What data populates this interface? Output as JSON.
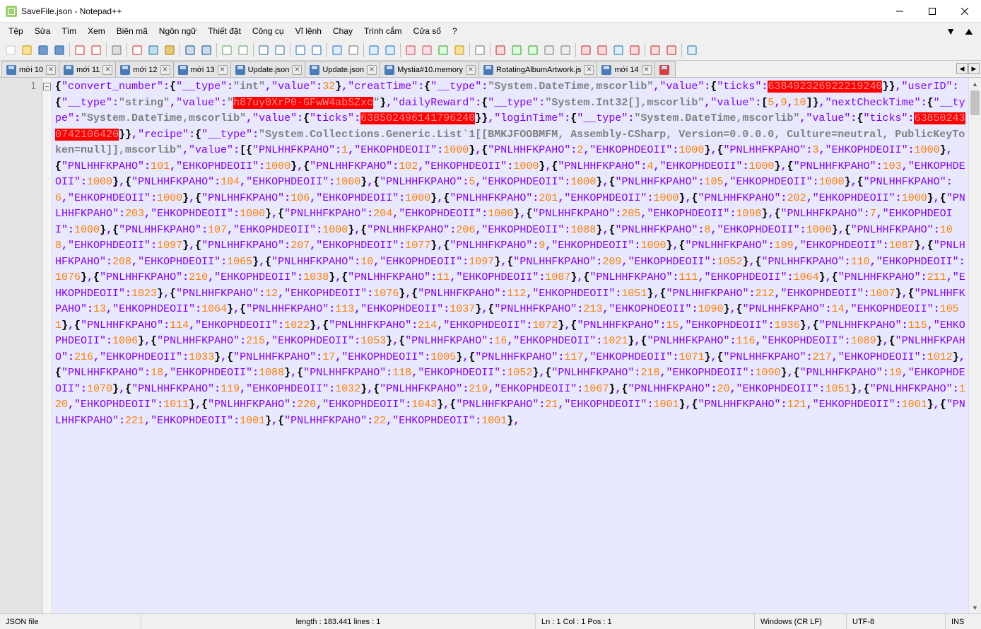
{
  "window": {
    "title": "SaveFile.json - Notepad++"
  },
  "menu": {
    "items": [
      "Tệp",
      "Sửa",
      "Tìm",
      "Xem",
      "Biên mã",
      "Ngôn ngữ",
      "Thiết đặt",
      "Công cụ",
      "Vĩ lệnh",
      "Chạy",
      "Trình cắm",
      "Cửa sổ",
      "?"
    ]
  },
  "tabs": [
    {
      "label": "mới 10",
      "unsaved": false
    },
    {
      "label": "mới 11",
      "unsaved": false
    },
    {
      "label": "mới 12",
      "unsaved": false
    },
    {
      "label": "mới 13",
      "unsaved": false
    },
    {
      "label": "Update.json",
      "unsaved": false
    },
    {
      "label": "Update.json",
      "unsaved": false
    },
    {
      "label": "Mystia#10.memory",
      "unsaved": false
    },
    {
      "label": "RotatingAlbumArtwork.js",
      "unsaved": false
    },
    {
      "label": "mới 14",
      "unsaved": false
    },
    {
      "label": "",
      "unsaved": true
    }
  ],
  "line_number": "1",
  "code_tokens": [
    {
      "t": "{",
      "c": "b"
    },
    {
      "t": "\"convert_number\"",
      "c": "k"
    },
    {
      "t": ":",
      "c": "p"
    },
    {
      "t": "{",
      "c": "b"
    },
    {
      "t": "\"__type\"",
      "c": "k"
    },
    {
      "t": ":",
      "c": "p"
    },
    {
      "t": "\"int\"",
      "c": "s"
    },
    {
      "t": ",",
      "c": "p"
    },
    {
      "t": "\"value\"",
      "c": "k"
    },
    {
      "t": ":",
      "c": "p"
    },
    {
      "t": "32",
      "c": "n"
    },
    {
      "t": "}",
      "c": "b"
    },
    {
      "t": ",",
      "c": "p"
    },
    {
      "t": "\"creatTime\"",
      "c": "k"
    },
    {
      "t": ":",
      "c": "p"
    },
    {
      "t": "{",
      "c": "b"
    },
    {
      "t": "\"__type\"",
      "c": "k"
    },
    {
      "t": ":",
      "c": "p"
    },
    {
      "t": "\"System.DateTime,mscorlib\"",
      "c": "s"
    },
    {
      "t": ",",
      "c": "p"
    },
    {
      "t": "\"value\"",
      "c": "k"
    },
    {
      "t": ":",
      "c": "p"
    },
    {
      "t": "{",
      "c": "b"
    },
    {
      "t": "\"ticks\"",
      "c": "k"
    },
    {
      "t": ":",
      "c": "p"
    },
    {
      "t": "638492326922219240",
      "c": "red"
    },
    {
      "t": "}",
      "c": "b"
    },
    {
      "t": "}",
      "c": "b"
    },
    {
      "t": ",",
      "c": "p"
    },
    {
      "t": "\"userID\"",
      "c": "k"
    },
    {
      "t": ":",
      "c": "p"
    },
    {
      "t": "{",
      "c": "b"
    },
    {
      "t": "\"__type\"",
      "c": "k"
    },
    {
      "t": ":",
      "c": "p"
    },
    {
      "t": "\"string\"",
      "c": "s"
    },
    {
      "t": ",",
      "c": "p"
    },
    {
      "t": "\"value\"",
      "c": "k"
    },
    {
      "t": ":",
      "c": "p"
    },
    {
      "t": "\"",
      "c": "s"
    },
    {
      "t": "h87uy0XrP0-GFwW4abSZxc",
      "c": "red"
    },
    {
      "t": "\"",
      "c": "s"
    },
    {
      "t": "}",
      "c": "b"
    },
    {
      "t": ",",
      "c": "p"
    },
    {
      "t": "\"dailyReward\"",
      "c": "k"
    },
    {
      "t": ":",
      "c": "p"
    },
    {
      "t": "{",
      "c": "b"
    },
    {
      "t": "\"__type\"",
      "c": "k"
    },
    {
      "t": ":",
      "c": "p"
    },
    {
      "t": "\"System.Int32[],mscorlib\"",
      "c": "s"
    },
    {
      "t": ",",
      "c": "p"
    },
    {
      "t": "\"value\"",
      "c": "k"
    },
    {
      "t": ":",
      "c": "p"
    },
    {
      "t": "[",
      "c": "b"
    },
    {
      "t": "5",
      "c": "n"
    },
    {
      "t": ",",
      "c": "p"
    },
    {
      "t": "9",
      "c": "n"
    },
    {
      "t": ",",
      "c": "p"
    },
    {
      "t": "10",
      "c": "n"
    },
    {
      "t": "]",
      "c": "b"
    },
    {
      "t": "}",
      "c": "b"
    },
    {
      "t": ",",
      "c": "p"
    },
    {
      "t": "\"nextCheckTime\"",
      "c": "k"
    },
    {
      "t": ":",
      "c": "p"
    },
    {
      "t": "{",
      "c": "b"
    },
    {
      "t": "\"__type\"",
      "c": "k"
    },
    {
      "t": ":",
      "c": "p"
    },
    {
      "t": "\"System.DateTime,mscorlib\"",
      "c": "s"
    },
    {
      "t": ",",
      "c": "p"
    },
    {
      "t": "\"value\"",
      "c": "k"
    },
    {
      "t": ":",
      "c": "p"
    },
    {
      "t": "{",
      "c": "b"
    },
    {
      "t": "\"ticks\"",
      "c": "k"
    },
    {
      "t": ":",
      "c": "p"
    },
    {
      "t": "638502496141796240",
      "c": "red"
    },
    {
      "t": "}",
      "c": "b"
    },
    {
      "t": "}",
      "c": "b"
    },
    {
      "t": ",",
      "c": "p"
    },
    {
      "t": "\"loginTime\"",
      "c": "k"
    },
    {
      "t": ":",
      "c": "p"
    },
    {
      "t": "{",
      "c": "b"
    },
    {
      "t": "\"__type\"",
      "c": "k"
    },
    {
      "t": ":",
      "c": "p"
    },
    {
      "t": "\"System.DateTime,mscorlib\"",
      "c": "s"
    },
    {
      "t": ",",
      "c": "p"
    },
    {
      "t": "\"value\"",
      "c": "k"
    },
    {
      "t": ":",
      "c": "p"
    },
    {
      "t": "{",
      "c": "b"
    },
    {
      "t": "\"ticks\"",
      "c": "k"
    },
    {
      "t": ":",
      "c": "p"
    },
    {
      "t": "638502430742106420",
      "c": "red"
    },
    {
      "t": "}",
      "c": "b"
    },
    {
      "t": "}",
      "c": "b"
    },
    {
      "t": ",",
      "c": "p"
    },
    {
      "t": "\"recipe\"",
      "c": "k"
    },
    {
      "t": ":",
      "c": "p"
    },
    {
      "t": "{",
      "c": "b"
    },
    {
      "t": "\"__type\"",
      "c": "k"
    },
    {
      "t": ":",
      "c": "p"
    },
    {
      "t": "\"System.Collections.Generic.List`1[[BMKJFOOBMFM, Assembly-CSharp, Version=0.0.0.0, Culture=neutral, PublicKeyToken=null]],mscorlib\"",
      "c": "s"
    },
    {
      "t": ",",
      "c": "p"
    },
    {
      "t": "\"value\"",
      "c": "k"
    },
    {
      "t": ":",
      "c": "p"
    },
    {
      "t": "[",
      "c": "b"
    }
  ],
  "recipe_items": [
    {
      "p": 1,
      "e": 1000
    },
    {
      "p": 2,
      "e": 1000
    },
    {
      "p": 3,
      "e": 1000
    },
    {
      "p": 101,
      "e": 1000
    },
    {
      "p": 102,
      "e": 1000
    },
    {
      "p": 4,
      "e": 1000
    },
    {
      "p": 103,
      "e": 1000
    },
    {
      "p": 104,
      "e": 1000
    },
    {
      "p": 5,
      "e": 1000
    },
    {
      "p": 105,
      "e": 1000
    },
    {
      "p": 6,
      "e": 1000
    },
    {
      "p": 106,
      "e": 1000
    },
    {
      "p": 201,
      "e": 1000
    },
    {
      "p": 202,
      "e": 1000
    },
    {
      "p": 203,
      "e": 1000
    },
    {
      "p": 204,
      "e": 1000
    },
    {
      "p": 205,
      "e": 1098
    },
    {
      "p": 7,
      "e": 1000
    },
    {
      "p": 107,
      "e": 1000
    },
    {
      "p": 206,
      "e": 1088
    },
    {
      "p": 8,
      "e": 1000
    },
    {
      "p": 108,
      "e": 1097
    },
    {
      "p": 207,
      "e": 1077
    },
    {
      "p": 9,
      "e": 1000
    },
    {
      "p": 109,
      "e": 1087
    },
    {
      "p": 208,
      "e": 1065
    },
    {
      "p": 10,
      "e": 1097
    },
    {
      "p": 209,
      "e": 1052
    },
    {
      "p": 110,
      "e": 1076
    },
    {
      "p": 210,
      "e": 1038
    },
    {
      "p": 11,
      "e": 1087
    },
    {
      "p": 111,
      "e": 1064
    },
    {
      "p": 211,
      "e": 1023
    },
    {
      "p": 12,
      "e": 1076
    },
    {
      "p": 112,
      "e": 1051
    },
    {
      "p": 212,
      "e": 1007
    },
    {
      "p": 13,
      "e": 1064
    },
    {
      "p": 113,
      "e": 1037
    },
    {
      "p": 213,
      "e": 1090
    },
    {
      "p": 14,
      "e": 1051
    },
    {
      "p": 114,
      "e": 1022
    },
    {
      "p": 214,
      "e": 1072
    },
    {
      "p": 15,
      "e": 1036
    },
    {
      "p": 115,
      "e": 1006
    },
    {
      "p": 215,
      "e": 1053
    },
    {
      "p": 16,
      "e": 1021
    },
    {
      "p": 116,
      "e": 1089
    },
    {
      "p": 216,
      "e": 1033
    },
    {
      "p": 17,
      "e": 1005
    },
    {
      "p": 117,
      "e": 1071
    },
    {
      "p": 217,
      "e": 1012
    },
    {
      "p": 18,
      "e": 1088
    },
    {
      "p": 118,
      "e": 1052
    },
    {
      "p": 218,
      "e": 1090
    },
    {
      "p": 19,
      "e": 1070
    },
    {
      "p": 119,
      "e": 1032
    },
    {
      "p": 219,
      "e": 1067
    },
    {
      "p": 20,
      "e": 1051
    },
    {
      "p": 120,
      "e": 1011
    },
    {
      "p": 220,
      "e": 1043
    },
    {
      "p": 21,
      "e": 1001
    },
    {
      "p": 121,
      "e": 1001
    },
    {
      "p": 221,
      "e": 1001
    },
    {
      "p": 22,
      "e": 1001
    }
  ],
  "status": {
    "type": "JSON file",
    "length": "length : 183.441    lines : 1",
    "pos": "Ln : 1    Col : 1    Pos : 1",
    "eol": "Windows (CR LF)",
    "enc": "UTF-8",
    "mode": "INS"
  }
}
